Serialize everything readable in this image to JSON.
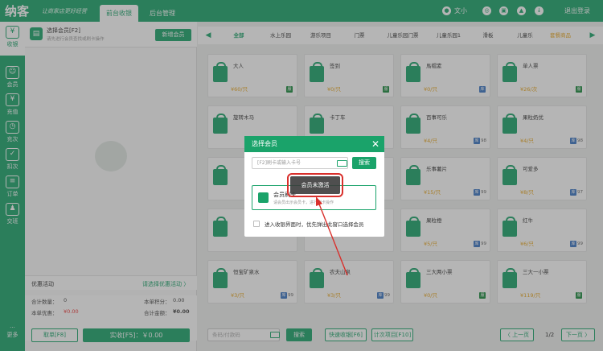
{
  "app": {
    "logo": "纳客",
    "slogan": "让商家店更好经营"
  },
  "top_tabs": [
    {
      "label": "前台收银",
      "active": true
    },
    {
      "label": "后台管理",
      "active": false
    }
  ],
  "user": {
    "name": "文小",
    "logout": "退出登录"
  },
  "sidebar": [
    {
      "label": "收银",
      "icon": "cashier-icon",
      "active": true
    },
    {
      "label": "会员",
      "icon": "member-icon"
    },
    {
      "label": "充值",
      "icon": "recharge-icon"
    },
    {
      "label": "充次",
      "icon": "times-icon"
    },
    {
      "label": "扣次",
      "icon": "deduct-icon"
    },
    {
      "label": "订单",
      "icon": "order-icon"
    },
    {
      "label": "交班",
      "icon": "handover-icon"
    },
    {
      "label": "更多",
      "icon": "more-icon"
    }
  ],
  "member_panel": {
    "title": "选择会员[F2]",
    "subtitle": "请先进行会员查找或刷卡操作",
    "new_member": "新增会员",
    "promo_label": "优惠活动",
    "promo_link": "请选择优惠活动 〉",
    "total_qty_label": "合计数量：",
    "total_qty": "0",
    "points_label": "本单积分：",
    "points": "0.00",
    "discount_label": "本单优惠：",
    "discount": "¥0.00",
    "total_amount_label": "合计金额：",
    "total_amount": "¥0.00",
    "hold_order": "取单[F8]",
    "checkout": "实收[F5]：￥0.00"
  },
  "categories": [
    "全部",
    "水上乐园",
    "游乐项目",
    "门票",
    "儿童乐园门票",
    "儿童乐园1",
    "滑板",
    "儿童乐",
    "套餐商品"
  ],
  "products": [
    {
      "name": "大人",
      "price": "¥60/只",
      "stock": "",
      "tag": "服",
      "tag_color": "green"
    },
    {
      "name": "签到",
      "price": "¥0/只",
      "stock": "",
      "tag": "服",
      "tag_color": "green"
    },
    {
      "name": "馬帽素",
      "price": "¥0/只",
      "stock": "",
      "tag": "库",
      "tag_color": "blue"
    },
    {
      "name": "单人票",
      "price": "¥26/次",
      "stock": "",
      "tag": "服",
      "tag_color": "green"
    },
    {
      "name": "旋转木马",
      "price": "",
      "stock": "",
      "tag": "",
      "tag_color": ""
    },
    {
      "name": "卡丁车",
      "price": "",
      "stock": "",
      "tag": "",
      "tag_color": ""
    },
    {
      "name": "百事可乐",
      "price": "¥4/只",
      "stock": "98",
      "tag": "库",
      "tag_color": "blue"
    },
    {
      "name": "果粒奶优",
      "price": "¥4/只",
      "stock": "98",
      "tag": "库",
      "tag_color": "blue"
    },
    {
      "name": "",
      "price": "",
      "stock": "",
      "tag": "",
      "tag_color": ""
    },
    {
      "name": "",
      "price": "",
      "stock": "",
      "tag": "",
      "tag_color": ""
    },
    {
      "name": "乐事薯片",
      "price": "¥15/只",
      "stock": "99",
      "tag": "库",
      "tag_color": "blue"
    },
    {
      "name": "可爱多",
      "price": "¥8/只",
      "stock": "97",
      "tag": "库",
      "tag_color": "blue"
    },
    {
      "name": "",
      "price": "",
      "stock": "",
      "tag": "",
      "tag_color": ""
    },
    {
      "name": "",
      "price": "",
      "stock": "",
      "tag": "",
      "tag_color": ""
    },
    {
      "name": "果粒橙",
      "price": "¥5/只",
      "stock": "99",
      "tag": "库",
      "tag_color": "blue"
    },
    {
      "name": "红牛",
      "price": "¥6/只",
      "stock": "99",
      "tag": "库",
      "tag_color": "blue"
    },
    {
      "name": "恒宝矿泉水",
      "price": "¥3/只",
      "stock": "99",
      "tag": "库",
      "tag_color": "blue"
    },
    {
      "name": "农夫山泉",
      "price": "¥3/只",
      "stock": "99",
      "tag": "库",
      "tag_color": "blue"
    },
    {
      "name": "三大两小票",
      "price": "¥0/只",
      "stock": "",
      "tag": "服",
      "tag_color": "green"
    },
    {
      "name": "三大一小票",
      "price": "¥119/只",
      "stock": "",
      "tag": "服",
      "tag_color": "green"
    }
  ],
  "footer": {
    "search_placeholder": "条码/付款码",
    "search_btn": "搜索",
    "quick_cashier": "快速收银[F6]",
    "times_item": "计次项目[F10]",
    "prev": "〈 上一页",
    "page": "1/2",
    "next": "下一页 〉"
  },
  "modal": {
    "title": "选择会员",
    "input_placeholder": "[F2]刷卡或输入卡号",
    "search": "搜索",
    "option_title": "会员刷卡",
    "option_sub": "请会员出示会员卡，进行刷卡操作",
    "checkbox_label": "进入收银界面时，优先弹出此窗口选择会员",
    "toast": "会员未激活"
  }
}
